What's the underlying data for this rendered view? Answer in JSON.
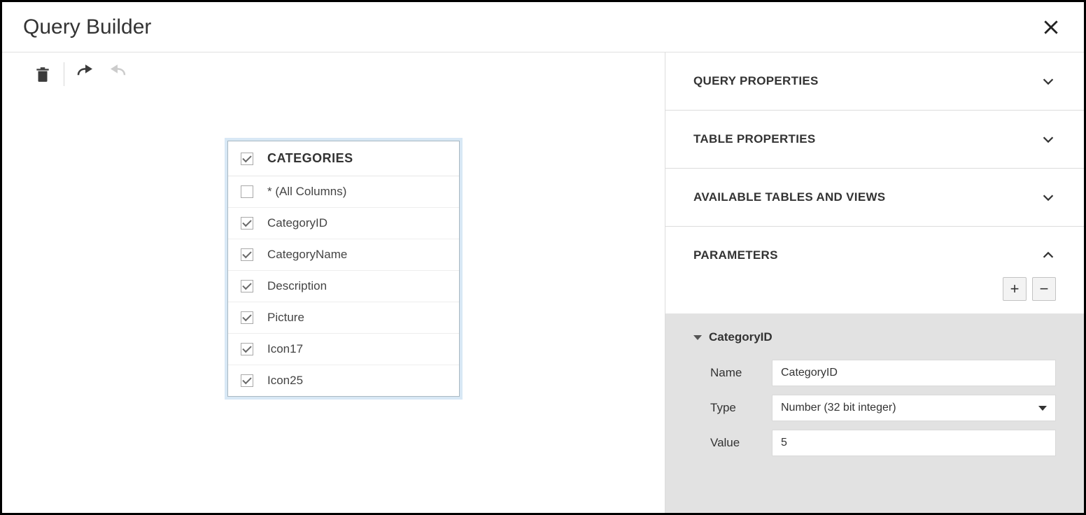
{
  "header": {
    "title": "Query Builder"
  },
  "canvas": {
    "table": {
      "name": "CATEGORIES",
      "checked": true,
      "columns": [
        {
          "label": "* (All Columns)",
          "checked": false
        },
        {
          "label": "CategoryID",
          "checked": true
        },
        {
          "label": "CategoryName",
          "checked": true
        },
        {
          "label": "Description",
          "checked": true
        },
        {
          "label": "Picture",
          "checked": true
        },
        {
          "label": "Icon17",
          "checked": true
        },
        {
          "label": "Icon25",
          "checked": true
        }
      ]
    }
  },
  "panels": {
    "queryProperties": {
      "title": "QUERY PROPERTIES",
      "open": false
    },
    "tableProperties": {
      "title": "TABLE PROPERTIES",
      "open": false
    },
    "availableTables": {
      "title": "AVAILABLE TABLES AND VIEWS",
      "open": false
    },
    "parameters": {
      "title": "PARAMETERS",
      "open": true,
      "actions": {
        "add": "+",
        "remove": "−"
      },
      "selected": {
        "heading": "CategoryID",
        "fields": {
          "nameLabel": "Name",
          "nameValue": "CategoryID",
          "typeLabel": "Type",
          "typeValue": "Number (32 bit integer)",
          "valueLabel": "Value",
          "valueValue": "5"
        }
      }
    }
  }
}
